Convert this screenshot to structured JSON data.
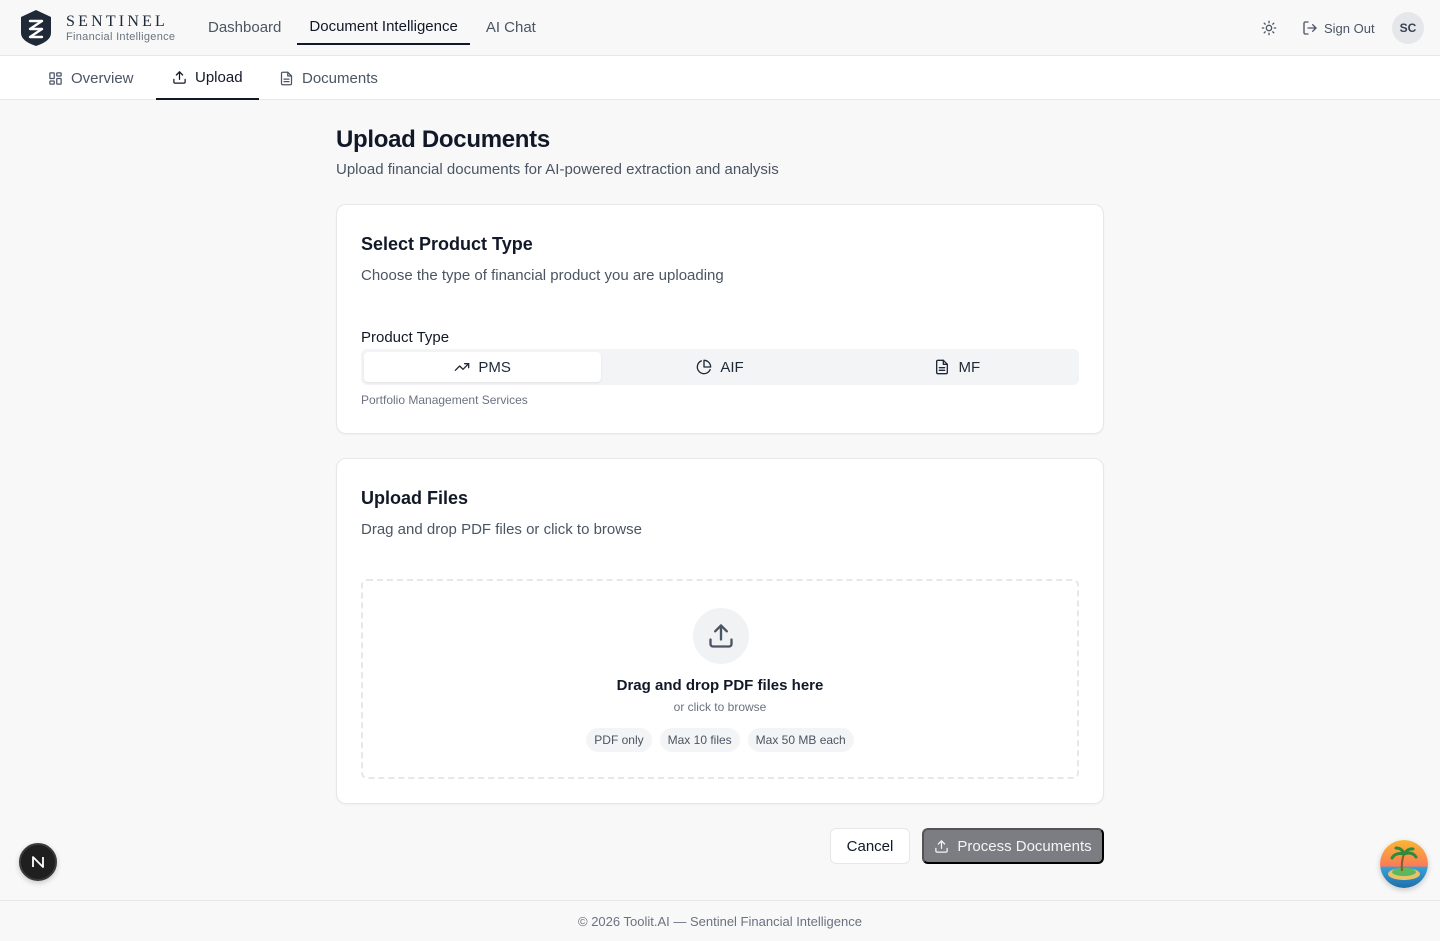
{
  "brand": {
    "name": "SENTINEL",
    "tagline": "Financial Intelligence"
  },
  "mainnav": [
    {
      "label": "Dashboard"
    },
    {
      "label": "Document Intelligence",
      "active": true
    },
    {
      "label": "AI Chat"
    }
  ],
  "header": {
    "signout_label": "Sign Out",
    "avatar_initials": "SC",
    "theme_icon": "sun-icon"
  },
  "subnav": [
    {
      "label": "Overview",
      "icon": "grid-icon"
    },
    {
      "label": "Upload",
      "icon": "upload-icon",
      "active": true
    },
    {
      "label": "Documents",
      "icon": "file-icon"
    }
  ],
  "page": {
    "title": "Upload Documents",
    "subtitle": "Upload financial documents for AI-powered extraction and analysis"
  },
  "product_card": {
    "title": "Select Product Type",
    "description": "Choose the type of financial product you are uploading",
    "field_label": "Product Type",
    "options": [
      {
        "label": "PMS",
        "icon": "trending-up-icon",
        "selected": true
      },
      {
        "label": "AIF",
        "icon": "pie-chart-icon"
      },
      {
        "label": "MF",
        "icon": "file-text-icon"
      }
    ],
    "help_text": "Portfolio Management Services"
  },
  "upload_card": {
    "title": "Upload Files",
    "description": "Drag and drop PDF files or click to browse",
    "dropzone_title": "Drag and drop PDF files here",
    "dropzone_sub": "or click to browse",
    "chips": [
      "PDF only",
      "Max 10 files",
      "Max 50 MB each"
    ]
  },
  "actions": {
    "cancel_label": "Cancel",
    "process_label": "Process Documents"
  },
  "footer": {
    "text": "© 2026 Toolit.AI — Sentinel Financial Intelligence"
  },
  "colors": {
    "primary": "#111827",
    "muted": "#4b5563",
    "border": "#e5e7eb",
    "process_button": "#7b7d83"
  }
}
